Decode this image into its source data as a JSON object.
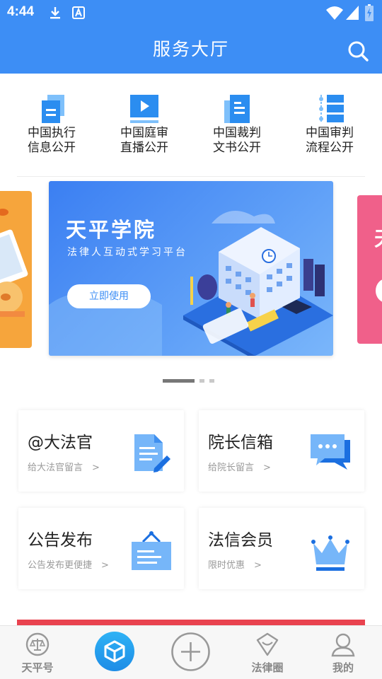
{
  "status_bar": {
    "time": "4:44"
  },
  "header": {
    "title": "服务大厅",
    "icon": "search-icon"
  },
  "quick_links": [
    {
      "line1": "中国执行",
      "line2": "信息公开",
      "icon": "document-stack-icon"
    },
    {
      "line1": "中国庭审",
      "line2": "直播公开",
      "icon": "play-screen-icon"
    },
    {
      "line1": "中国裁判",
      "line2": "文书公开",
      "icon": "document-icon"
    },
    {
      "line1": "中国审判",
      "line2": "流程公开",
      "icon": "process-list-icon"
    }
  ],
  "banner": {
    "title": "天平学院",
    "subtitle": "法律人互动式学习平台",
    "button": "立即使用",
    "right_peek_char": "天"
  },
  "cards": [
    {
      "title": "@大法官",
      "subtitle": "给大法官留言　>",
      "icon": "edit-document-icon"
    },
    {
      "title": "院长信箱",
      "subtitle": "给院长留言　>",
      "icon": "chat-bubble-icon"
    },
    {
      "title": "公告发布",
      "subtitle": "公告发布更便捷　>",
      "icon": "notice-board-icon"
    },
    {
      "title": "法信会员",
      "subtitle": "限时优惠　>",
      "icon": "crown-icon"
    }
  ],
  "bottom_nav": [
    {
      "label": "天平号",
      "icon": "scales-icon"
    },
    {
      "label": "",
      "icon": "cube-icon"
    },
    {
      "label": "",
      "icon": "plus-circle-icon"
    },
    {
      "label": "法律圈",
      "icon": "gem-chat-icon"
    },
    {
      "label": "我的",
      "icon": "user-icon"
    }
  ],
  "colors": {
    "primary": "#3d8ef5",
    "accent": "#1d8ce6",
    "strip": "#e9434f"
  }
}
